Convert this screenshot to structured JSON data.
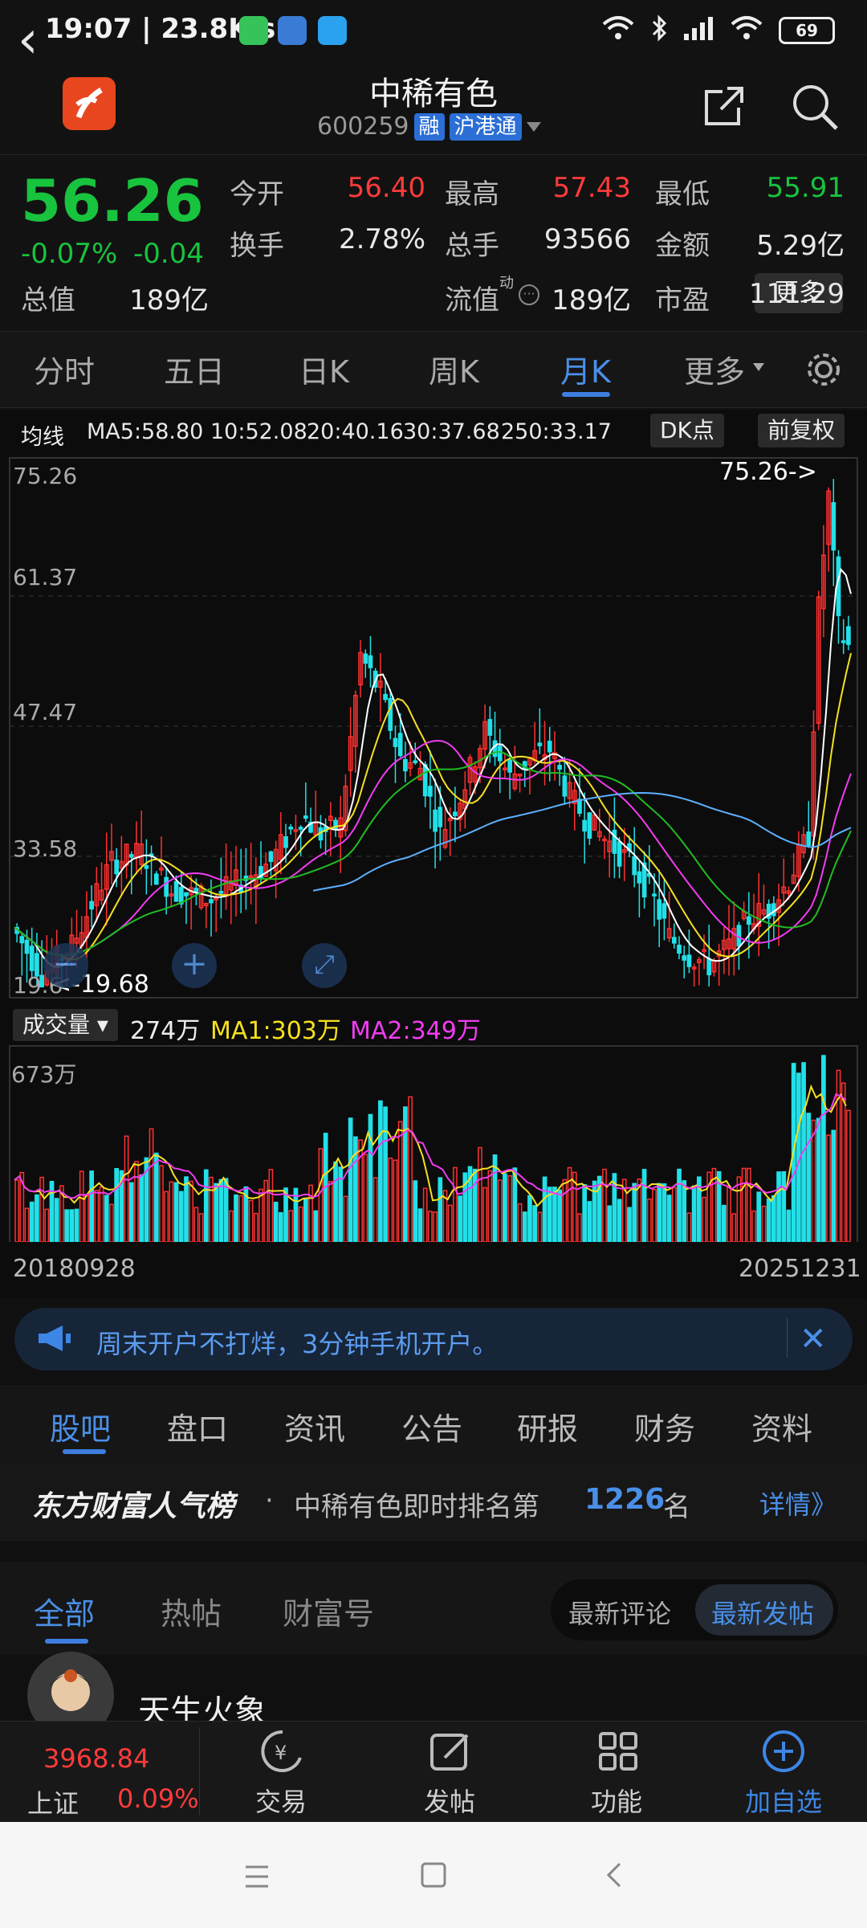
{
  "status": {
    "time": "19:07 | 23.8K/s",
    "battery": "69"
  },
  "header": {
    "back_icon": "‹",
    "title": "中稀有色",
    "code": "600259",
    "tag1": "融",
    "tag2": "沪港通"
  },
  "quote": {
    "price": "56.26",
    "change_pct": "-0.07%",
    "change": "-0.04",
    "fields": [
      {
        "label": "今开",
        "value": "56.40",
        "color": "#ff3b3b"
      },
      {
        "label": "最高",
        "value": "57.43",
        "color": "#ff3b3b"
      },
      {
        "label": "最低",
        "value": "55.91",
        "color": "#18c33e"
      },
      {
        "label": "换手",
        "value": "2.78%",
        "color": "#e8e8e8"
      },
      {
        "label": "总手",
        "value": "93566",
        "color": "#e8e8e8"
      },
      {
        "label": "金额",
        "value": "5.29亿",
        "color": "#e8e8e8"
      },
      {
        "label": "总值",
        "value": "189亿",
        "color": "#e8e8e8"
      },
      {
        "label": "流值",
        "value": "189亿",
        "color": "#e8e8e8"
      },
      {
        "label": "市盈",
        "value": "111.29",
        "color": "#e8e8e8"
      }
    ],
    "pe_sup": "动",
    "more": "更多"
  },
  "tabs": [
    "分时",
    "五日",
    "日K",
    "周K",
    "月K",
    "更多"
  ],
  "ma_row": {
    "label": "均线",
    "items": [
      {
        "text": "MA5:58.80",
        "color": "#ffffff"
      },
      {
        "text": "10:52.08",
        "color": "#f5e020"
      },
      {
        "text": "20:40.16",
        "color": "#f03cf0"
      },
      {
        "text": "30:37.68",
        "color": "#22bb22"
      },
      {
        "text": "250:33.17",
        "color": "#5db0ff"
      }
    ],
    "dk": "DK点",
    "adj": "前复权"
  },
  "chart_data": {
    "type": "candlestick",
    "title": "",
    "y_ticks": [
      "75.26",
      "61.37",
      "47.47",
      "33.58",
      "19.6"
    ],
    "ylim": [
      19.68,
      75.26
    ],
    "high_label": "75.26->",
    "low_label": "<-19.68",
    "x_start": "20180928",
    "x_end": "20251231",
    "ma_values": {
      "MA5": 58.8,
      "MA10": 52.08,
      "MA20": 40.16,
      "MA30": 37.68,
      "MA250": 33.17
    }
  },
  "volume": {
    "label": "成交量",
    "current": "274万",
    "ma1": "MA1:303万",
    "ma2": "MA2:349万",
    "max_label": "673万",
    "ma1_color": "#f5e020",
    "ma2_color": "#f03cf0"
  },
  "banner": {
    "text": "周末开户不打烊，3分钟手机开户。"
  },
  "news_tabs": [
    "股吧",
    "盘口",
    "资讯",
    "公告",
    "研报",
    "财务",
    "资料"
  ],
  "rank": {
    "brand": "东方财富人气榜",
    "text": "中稀有色即时排名第",
    "num": "1226",
    "unit": "名",
    "detail": "详情》"
  },
  "filter": {
    "tabs": [
      "全部",
      "热帖",
      "财富号"
    ],
    "sort": [
      "最新评论",
      "最新发帖"
    ]
  },
  "post": {
    "author": "天生火象"
  },
  "bottom": {
    "index_value": "3968.84",
    "index_name": "上证",
    "index_pct": "0.09%",
    "items": [
      "交易",
      "发帖",
      "功能",
      "加自选"
    ]
  }
}
